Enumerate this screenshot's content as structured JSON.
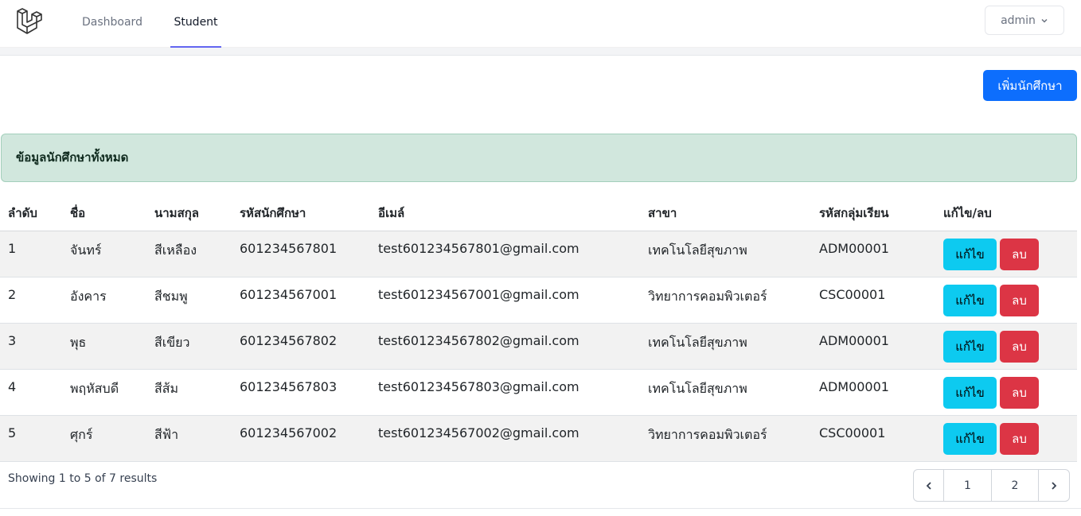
{
  "nav": {
    "logo_icon": "laravel-logo-icon",
    "links": [
      "Dashboard",
      "Student"
    ],
    "active": "Student",
    "user": "admin",
    "accent_color": "#6366f1"
  },
  "toolbar": {
    "add_label": "เพิ่มนักศึกษา",
    "add_color": "#0d6efd"
  },
  "alert": {
    "text": "ข้อมูลนักศึกษาทั้งหมด",
    "color": "#d1e7dd"
  },
  "table": {
    "headers": [
      "ลำดับ",
      "ชื่อ",
      "นามสกุล",
      "รหัสนักศึกษา",
      "อีเมล์",
      "สาขา",
      "รหัสกลุ่มเรียน",
      "แก้ไข/ลบ"
    ],
    "rows": [
      [
        "1",
        "จันทร์",
        "สีเหลือง",
        "601234567801",
        "test601234567801@gmail.com",
        "เทคโนโลยีสุขภาพ",
        "ADM00001"
      ],
      [
        "2",
        "อังคาร",
        "สีชมพู",
        "601234567001",
        "test601234567001@gmail.com",
        "วิทยาการคอมพิวเตอร์",
        "CSC00001"
      ],
      [
        "3",
        "พุธ",
        "สีเขียว",
        "601234567802",
        "test601234567802@gmail.com",
        "เทคโนโลยีสุขภาพ",
        "ADM00001"
      ],
      [
        "4",
        "พฤหัสบดี",
        "สีส้ม",
        "601234567803",
        "test601234567803@gmail.com",
        "เทคโนโลยีสุขภาพ",
        "ADM00001"
      ],
      [
        "5",
        "ศุกร์",
        "สีฟ้า",
        "601234567002",
        "test601234567002@gmail.com",
        "วิทยาการคอมพิวเตอร์",
        "CSC00001"
      ]
    ],
    "edit_label": "แก้ไข",
    "delete_label": "ลบ",
    "edit_color": "#0dcaf0",
    "delete_color": "#dc3545"
  },
  "pagination": {
    "summary": "Showing 1 to 5 of 7 results",
    "pages": [
      "1",
      "2"
    ],
    "current": "1"
  }
}
